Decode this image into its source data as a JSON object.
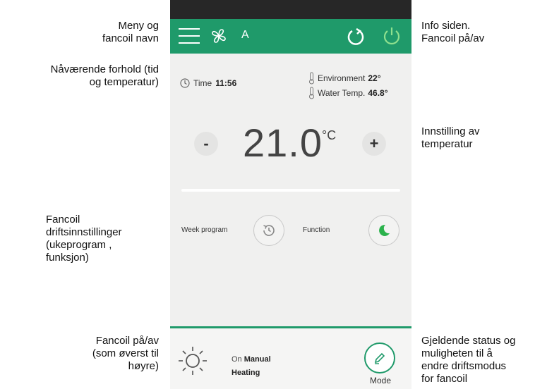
{
  "annotations": {
    "menu_name": "Meny og\nfancoil navn",
    "current_conditions": "Nåværende forhold (tid\nog temperatur)",
    "operating_settings": "Fancoil\ndriftsinnstillinger\n(ukeprogram     ,\nfunksjon)",
    "power_bottom": "Fancoil på/av\n(som øverst til\nhøyre)",
    "info_power": "Info siden.\nFancoil på/av",
    "temp_setting": "Innstilling av\ntemperatur",
    "status_mode": "Gjeldende status og\nmuligheten til å\nendre driftsmodus\nfor fancoil"
  },
  "app": {
    "fancoil_name": "A",
    "accent_color": "#1f9a6a",
    "icons": [
      "menu-icon",
      "fan-icon",
      "refresh-icon",
      "power-icon"
    ]
  },
  "conditions": {
    "time_label": "Time",
    "time_value": "11:56",
    "environment_label": "Environment",
    "environment_value": "22°",
    "water_label": "Water Temp.",
    "water_value": "46.8°"
  },
  "setpoint": {
    "value": "21.0",
    "unit": "°C",
    "minus": "-",
    "plus": "+"
  },
  "operations": {
    "week_program_label": "Week program",
    "function_label": "Function"
  },
  "status": {
    "state": "On",
    "mode": "Manual",
    "operation": "Heating",
    "mode_button_label": "Mode"
  }
}
